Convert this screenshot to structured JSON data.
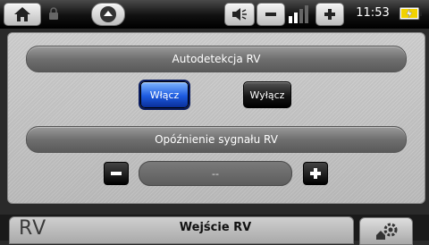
{
  "status_bar": {
    "clock": "11:53",
    "icons": {
      "home": "home-icon",
      "lock": "lock-icon",
      "menu": "menu-up-icon",
      "speaker": "speaker-icon",
      "volume_down": "minus-icon",
      "volume_up": "plus-icon",
      "volume_level": "volume-level-icon",
      "battery": "battery-charging-icon"
    }
  },
  "panel": {
    "autodetect": {
      "label": "Autodetekcja RV",
      "on_label": "Włącz",
      "off_label": "Wyłącz",
      "selected": "on"
    },
    "delay": {
      "label": "Opóźnienie sygnału RV",
      "value": "--",
      "decrease_icon": "minus-icon",
      "increase_icon": "plus-icon"
    }
  },
  "bottom_bar": {
    "logo_text": "RV",
    "title": "Wejście RV",
    "settings_icon": "gear-settings-icon"
  },
  "colors": {
    "accent_selected": "#1d5be0",
    "panel_bg": "#c8c8c8",
    "bar_dark": "#000000"
  }
}
